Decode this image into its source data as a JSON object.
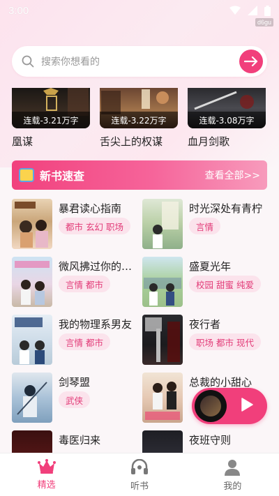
{
  "status": {
    "time": "3:00",
    "watermark": "d6gu"
  },
  "search": {
    "placeholder": "搜索你想看的"
  },
  "top_books": [
    {
      "title": "凰谋",
      "tag": "连载-3.21万字"
    },
    {
      "title": "舌尖上的权谋",
      "tag": "连载-3.22万字"
    },
    {
      "title": "血月剑歌",
      "tag": "连载-3.08万字"
    }
  ],
  "banner": {
    "title": "新书速查",
    "more": "查看全部>>"
  },
  "books": [
    {
      "title": "暴君读心指南",
      "tags": "都市 玄幻 职场"
    },
    {
      "title": "时光深处有青柠",
      "tags": "言情"
    },
    {
      "title": "微风拂过你的…",
      "tags": "言情 都市"
    },
    {
      "title": "盛夏光年",
      "tags": "校园 甜蜜 纯爱"
    },
    {
      "title": "我的物理系男友",
      "tags": "言情 都市"
    },
    {
      "title": "夜行者",
      "tags": "职场 都市 现代"
    },
    {
      "title": "剑琴盟",
      "tags": "武侠"
    },
    {
      "title": "总裁的小甜心",
      "tags": ""
    },
    {
      "title": "毒医归来",
      "tags": ""
    },
    {
      "title": "夜班守则",
      "tags": ""
    }
  ],
  "nav": [
    {
      "label": "精选",
      "icon": "crown-icon",
      "active": true
    },
    {
      "label": "听书",
      "icon": "headphones-icon",
      "active": false
    },
    {
      "label": "我的",
      "icon": "user-icon",
      "active": false
    }
  ],
  "colors": {
    "accent": "#f13f7b",
    "tag_bg": "#fbe3ec",
    "tag_text": "#e23a77"
  }
}
